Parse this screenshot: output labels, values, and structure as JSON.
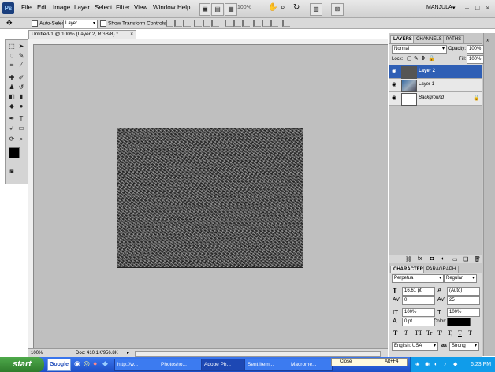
{
  "menubar": {
    "logo": "Ps",
    "items": [
      "File",
      "Edit",
      "Image",
      "Layer",
      "Select",
      "Filter",
      "View",
      "Window",
      "Help"
    ],
    "zoom": "100%",
    "workspace": "MANJULA",
    "win_min": "–",
    "win_max": "□",
    "win_close": "×"
  },
  "options": {
    "auto_select_label": "Auto-Select:",
    "auto_select_value": "Layer",
    "transform_label": "Show Transform Controls"
  },
  "document": {
    "tab_title": "Untitled-1 @ 100% (Layer 2, RGB/8) *",
    "tab_close": "×",
    "zoom": "100%",
    "doc_size": "Doc: 410.1K/956.8K"
  },
  "layers_panel": {
    "tabs": [
      "LAYERS",
      "CHANNELS",
      "PATHS"
    ],
    "blend_mode": "Normal",
    "opacity_label": "Opacity:",
    "opacity_value": "100%",
    "lock_label": "Lock:",
    "fill_label": "Fill:",
    "fill_value": "100%",
    "layers": [
      {
        "name": "Layer 2",
        "selected": true
      },
      {
        "name": "Layer 1",
        "selected": false
      },
      {
        "name": "Background",
        "selected": false
      }
    ]
  },
  "character_panel": {
    "tabs": [
      "CHARACTER",
      "PARAGRAPH"
    ],
    "font_family": "Perpetua",
    "font_style": "Regular",
    "font_size": "16.61 pt",
    "leading": "(Auto)",
    "kerning": "0",
    "tracking": "25",
    "vscale": "100%",
    "hscale": "100%",
    "baseline": "0 pt",
    "color_label": "Color:",
    "style_buttons": [
      "T",
      "T",
      "TT",
      "Tr",
      "T'",
      "T,",
      "T",
      "Ŧ"
    ],
    "language": "English: USA",
    "aa_label": "a",
    "antialias": "Strong"
  },
  "taskbar": {
    "start": "start",
    "google": "Google",
    "tasks": [
      "http://w...",
      "Photosho...",
      "Adobe Ph...",
      "Sent Item...",
      "Macrome..."
    ],
    "close_label": "Close",
    "close_shortcut": "Alt+F4",
    "clock": "6:23 PM"
  }
}
